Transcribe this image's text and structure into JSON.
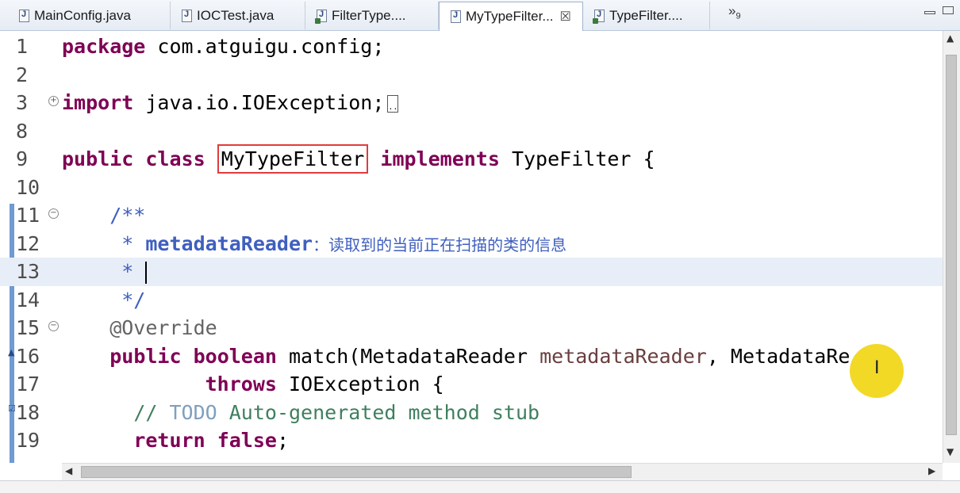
{
  "tabs": [
    {
      "label": "MainConfig.java",
      "icon": "java-file-icon",
      "active": false
    },
    {
      "label": "IOCTest.java",
      "icon": "java-file-icon",
      "active": false
    },
    {
      "label": "FilterType....",
      "icon": "class-file-icon",
      "active": false
    },
    {
      "label": "MyTypeFilter...",
      "icon": "java-file-icon",
      "active": true,
      "close": "☒"
    },
    {
      "label": "TypeFilter....",
      "icon": "class-file-icon",
      "active": false
    }
  ],
  "overflow_tabs": {
    "symbol": "»",
    "count": "9"
  },
  "editor": {
    "line_numbers": [
      "1",
      "2",
      "3",
      "8",
      "9",
      "10",
      "11",
      "12",
      "13",
      "14",
      "15",
      "16",
      "17",
      "18",
      "19"
    ],
    "code": {
      "l1_kw": "package",
      "l1_rest": " com.atguigu.config;",
      "l3_kw": "import",
      "l3_rest": " java.io.IOException;",
      "l9_kw1": "public",
      "l9_kw2": "class",
      "l9_cls": "MyTypeFilter",
      "l9_kw3": "implements",
      "l9_rest": " TypeFilter {",
      "l11": "    /**",
      "l12_star": "     * ",
      "l12_param": "metadataReader",
      "l12_cn": "：读取到的当前正在扫描的类的信息",
      "l13": "     * ",
      "l14": "     */",
      "l15": "    @Override",
      "l16_kw1": "public",
      "l16_kw2": "boolean",
      "l16_name": " match(MetadataReader ",
      "l16_param": "metadataReader",
      "l16_rest": ", MetadataRe",
      "l17_kw": "throws",
      "l17_rest": " IOException {",
      "l18_cm": "// ",
      "l18_todo": "TODO",
      "l18_rest": " Auto-generated method stub",
      "l19_kw1": "return",
      "l19_kw2": "false",
      "l19_rest": ";"
    },
    "current_line": "13"
  },
  "colors": {
    "keyword": "#7f0055",
    "javadoc": "#3f5fbf",
    "comment": "#3f7f5f",
    "highlight_box": "#e03c3c",
    "current_line_bg": "#e8eef7",
    "mouse_highlight": "#f0d200"
  }
}
